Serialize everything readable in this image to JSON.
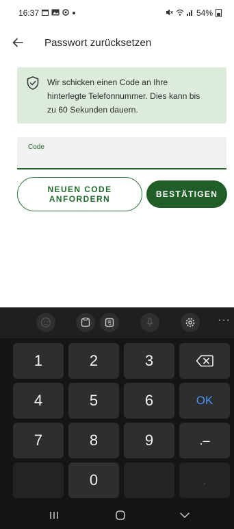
{
  "status_bar": {
    "time": "16:37",
    "battery": "54%",
    "icons": [
      "calendar-icon",
      "photo-icon",
      "sync-icon",
      "dot-icon",
      "mute-icon",
      "wifi-icon",
      "signal-icon",
      "battery-icon"
    ]
  },
  "app_bar": {
    "title": "Passwort zurücksetzen",
    "back_icon": "back-arrow-icon"
  },
  "info_banner": {
    "icon": "shield-check-icon",
    "lines": [
      "Wir schicken einen Code an Ihre",
      "hinterlegte Telefonnummer. Dies kann bis",
      "zu 60 Sekunden dauern."
    ],
    "bg_color": "#dcebdc"
  },
  "code_field": {
    "label": "Code",
    "value": "",
    "accent_color": "#1f6b2c"
  },
  "buttons": {
    "request_new_code_lines": [
      "NEUEN CODE",
      "ANFORDERN"
    ],
    "confirm_label": "BESTÄTIGEN",
    "confirm_color": "#1f5e26"
  },
  "keyboard": {
    "toolbar_icons": [
      "emoji-icon",
      "clipboard-icon",
      "text-edit-icon",
      "microphone-icon",
      "settings-icon",
      "more-icon"
    ],
    "more_label": "···",
    "keys": {
      "k1": "1",
      "k2": "2",
      "k3": "3",
      "k4": "4",
      "k5": "5",
      "k6": "6",
      "k7": "7",
      "k8": "8",
      "k9": "9",
      "k0": "0",
      "ok": "OK",
      "dot_dash": ".–",
      "comma": ","
    },
    "ok_color": "#4b93f2"
  },
  "navigation": {
    "icons": [
      "recent-apps-icon",
      "home-icon",
      "back-icon"
    ]
  }
}
